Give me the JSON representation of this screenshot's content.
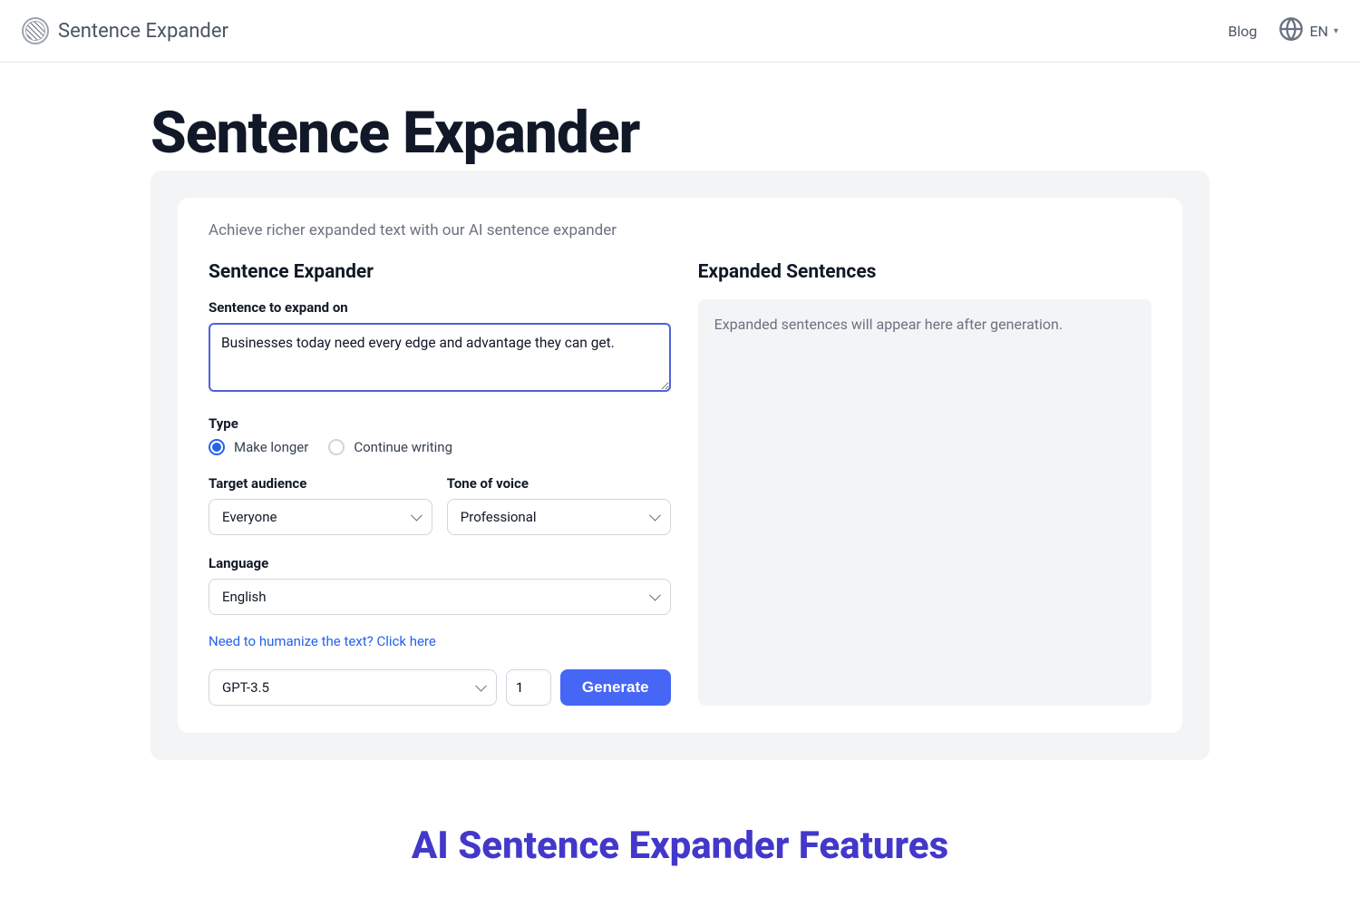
{
  "header": {
    "brand": "Sentence Expander",
    "blog": "Blog",
    "lang": "EN"
  },
  "page": {
    "title": "Sentence Expander",
    "subtitle": "Achieve richer expanded text with our AI sentence expander"
  },
  "left": {
    "heading": "Sentence Expander",
    "sentence_label": "Sentence to expand on",
    "sentence_value": "Businesses today need every edge and advantage they can get.",
    "type_label": "Type",
    "type_options": {
      "make_longer": "Make longer",
      "continue_writing": "Continue writing"
    },
    "type_selected": "make_longer",
    "target_audience_label": "Target audience",
    "target_audience_value": "Everyone",
    "tone_label": "Tone of voice",
    "tone_value": "Professional",
    "language_label": "Language",
    "language_value": "English",
    "humanize_link": "Need to humanize the text? Click here",
    "model_value": "GPT-3.5",
    "qty_value": "1",
    "generate_label": "Generate"
  },
  "right": {
    "heading": "Expanded Sentences",
    "placeholder": "Expanded sentences will appear here after generation."
  },
  "features": {
    "heading": "AI Sentence Expander Features"
  }
}
